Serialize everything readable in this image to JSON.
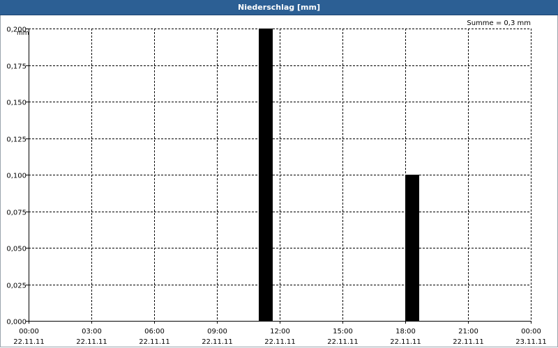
{
  "window": {
    "title": "Niederschlag [mm]"
  },
  "chart_data": {
    "type": "bar",
    "title": "Niederschlag [mm]",
    "ylabel": "mm",
    "summary": "Summe = 0,3 mm",
    "ylim": [
      0,
      0.2
    ],
    "yticks": [
      "0,000",
      "0,025",
      "0,050",
      "0,075",
      "0,100",
      "0,125",
      "0,150",
      "0,175",
      "0,200"
    ],
    "xlim_hours": [
      0,
      24
    ],
    "xticks": [
      {
        "time": "00:00",
        "date": "22.11.11"
      },
      {
        "time": "03:00",
        "date": "22.11.11"
      },
      {
        "time": "06:00",
        "date": "22.11.11"
      },
      {
        "time": "09:00",
        "date": "22.11.11"
      },
      {
        "time": "12:00",
        "date": "22.11.11"
      },
      {
        "time": "15:00",
        "date": "22.11.11"
      },
      {
        "time": "18:00",
        "date": "22.11.11"
      },
      {
        "time": "21:00",
        "date": "22.11.11"
      },
      {
        "time": "00:00",
        "date": "23.11.11"
      }
    ],
    "x": [
      "22.11.11 11:00",
      "22.11.11 18:00"
    ],
    "values": [
      0.2,
      0.1
    ],
    "bar_color": "#000000",
    "grid": true
  }
}
